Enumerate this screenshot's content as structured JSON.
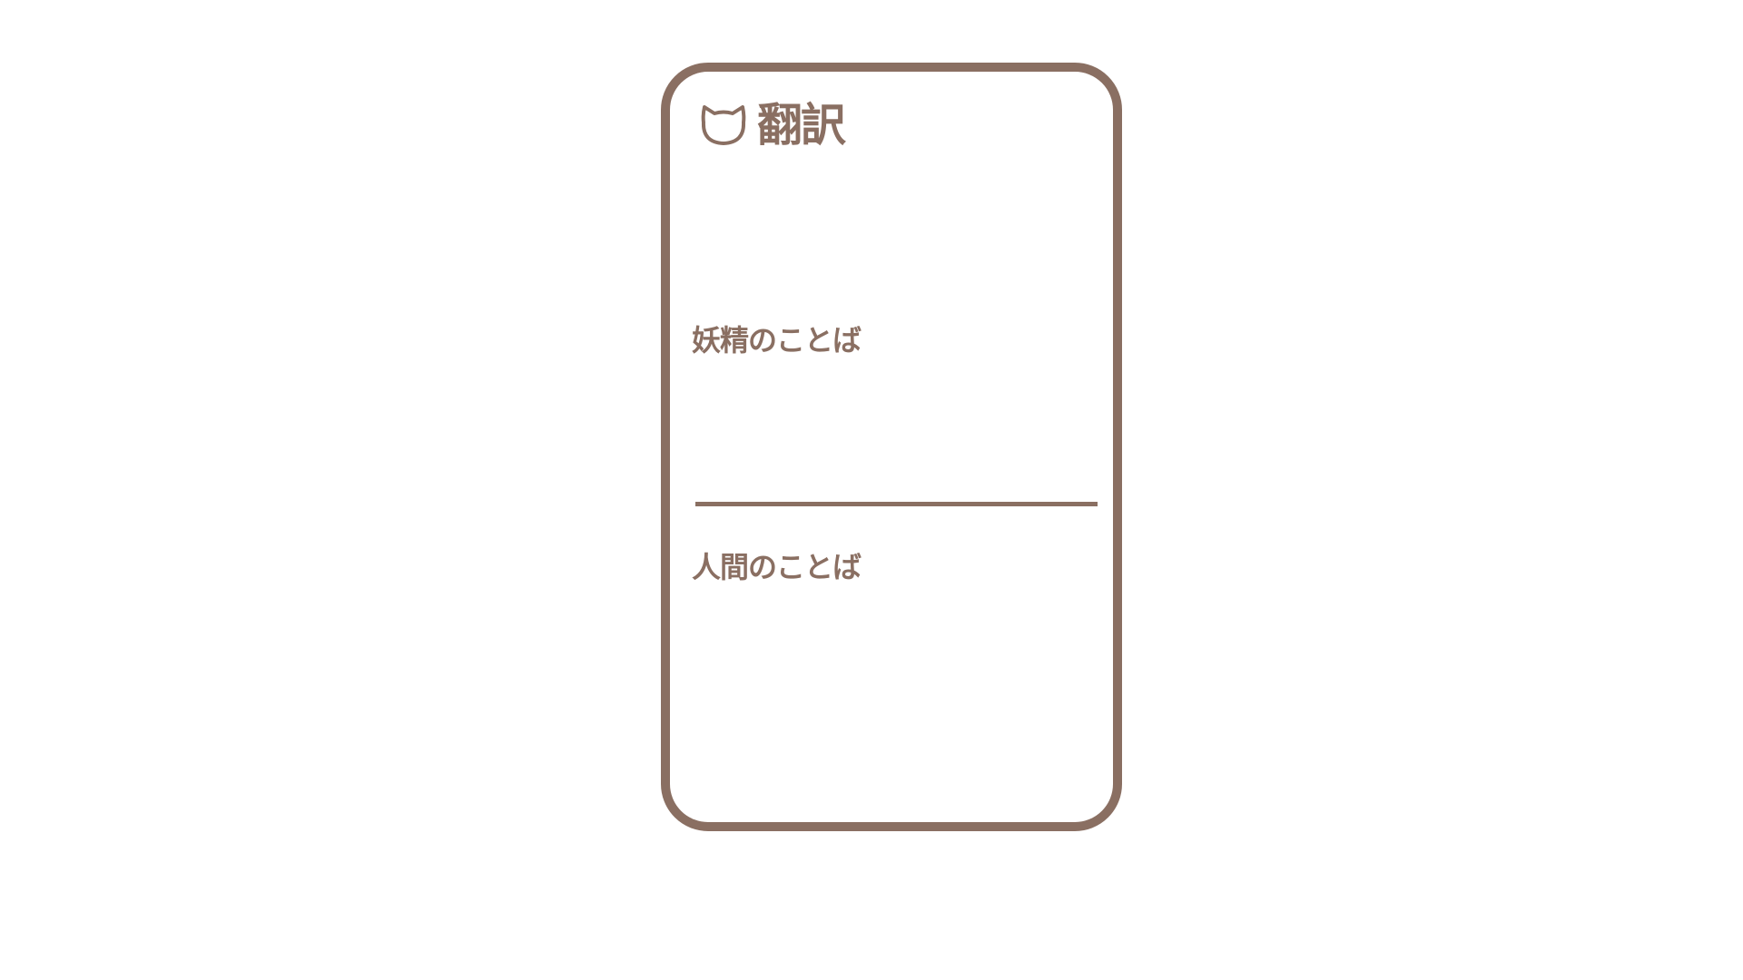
{
  "header": {
    "icon": "cat-icon",
    "title": "翻訳"
  },
  "fairy_section": {
    "label": "妖精のことば",
    "text": ""
  },
  "human_section": {
    "label": "人間のことば",
    "text": ""
  },
  "colors": {
    "accent": "#8a6f62",
    "background": "#ffffff"
  }
}
